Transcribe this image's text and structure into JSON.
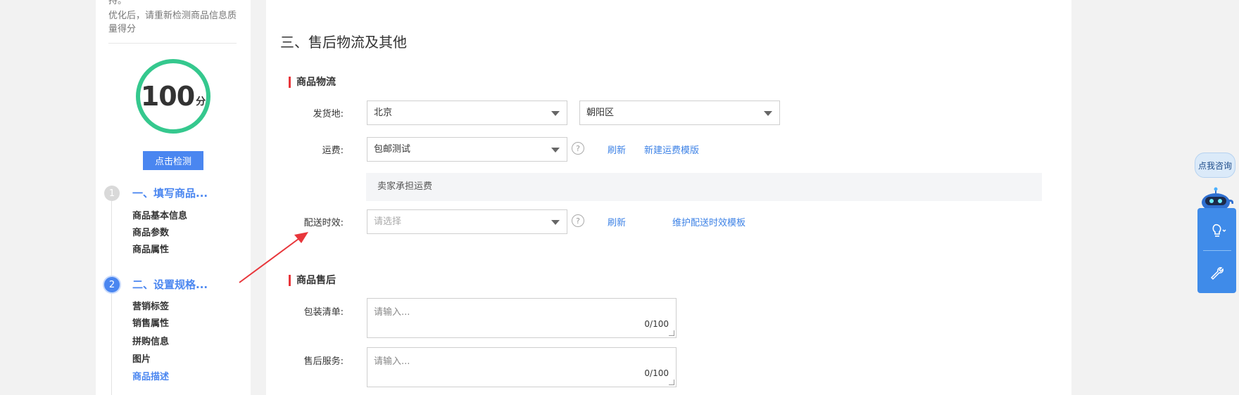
{
  "sidebar": {
    "tip_top": "持。",
    "tip": "优化后，请重新检测商品信息质量得分",
    "score": "100",
    "score_unit": "分",
    "check_button": "点击检测",
    "steps": [
      {
        "num": "1",
        "title": "一、填写商品...",
        "items": [
          "商品基本信息",
          "商品参数",
          "商品属性"
        ]
      },
      {
        "num": "2",
        "title": "二、设置规格...",
        "items": [
          "营销标签",
          "销售属性",
          "拼购信息",
          "图片",
          "商品描述"
        ]
      }
    ],
    "active_item": "商品描述"
  },
  "main": {
    "section_title": "三、售后物流及其他",
    "logistics": {
      "title": "商品物流",
      "origin_label": "发货地:",
      "origin_province": "北京",
      "origin_district": "朝阳区",
      "freight_label": "运费:",
      "freight_value": "包邮测试",
      "freight_help": "?",
      "refresh": "刷新",
      "new_freight_template": "新建运费模版",
      "freight_note": "卖家承担运费",
      "delivery_label": "配送时效:",
      "delivery_placeholder": "请选择",
      "delivery_help": "?",
      "delivery_refresh": "刷新",
      "maintain_template": "维护配送时效模板"
    },
    "aftersale": {
      "title": "商品售后",
      "packing_label": "包装清单:",
      "packing_placeholder": "请输入...",
      "packing_count": "0/100",
      "service_label": "售后服务:",
      "service_placeholder": "请输入...",
      "service_count": "0/100"
    }
  },
  "widget": {
    "consult": "点我咨询",
    "icons": [
      "lightbulb-icon",
      "wrench-icon"
    ]
  },
  "colors": {
    "accent": "#4a86f0",
    "link": "#3d82e6",
    "score_ring": "#35c88e",
    "group_bar": "#e8363b",
    "annotation_arrow": "#e8363b"
  }
}
